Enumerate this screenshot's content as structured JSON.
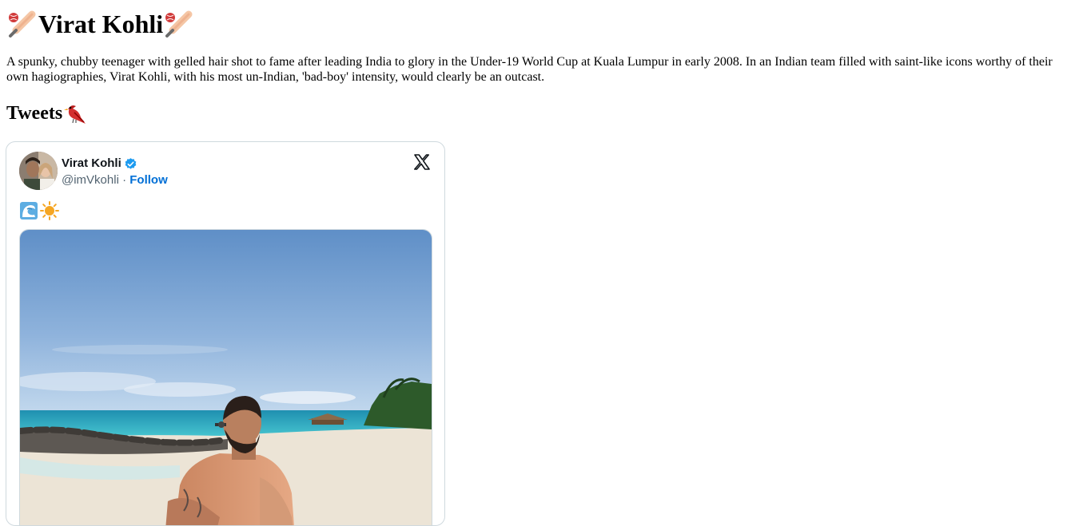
{
  "page": {
    "title": "Virat Kohli",
    "title_icon": "cricket-bat-and-ball-icon",
    "intro": "A spunky, chubby teenager with gelled hair shot to fame after leading India to glory in the Under-19 World Cup at Kuala Lumpur in early 2008. In an Indian team filled with saint-like icons worthy of their own hagiographies, Virat Kohli, with his most un-Indian, 'bad-boy' intensity, would clearly be an outcast.",
    "section_heading": "Tweets",
    "section_icon": "red-bird-icon"
  },
  "tweet": {
    "author_name": "Virat Kohli",
    "handle": "@imVkohli",
    "separator": "·",
    "follow_label": "Follow",
    "verified_color": "#1d9bf0",
    "follow_color": "#006fd6",
    "emojis": [
      "water-wave-icon",
      "sun-icon"
    ],
    "media_description_icon": "beach-photo"
  },
  "colors": {
    "card_border": "#cfd9de",
    "handle_text": "#536471",
    "name_text": "#0f1419"
  }
}
